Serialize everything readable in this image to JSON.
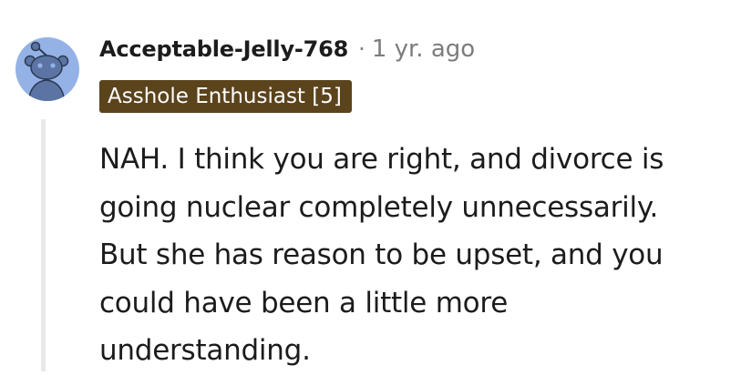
{
  "comment": {
    "author": "Acceptable-Jelly-768",
    "separator": "·",
    "age": "1 yr. ago",
    "flair": "Asshole Enthusiast [5]",
    "body_lines": [
      "NAH. I think you are right, and divorce is",
      "going nuclear completely unnecessarily.",
      "But she has reason to be upset, and you",
      "could have been a little more",
      "understanding."
    ]
  },
  "avatar_icon": "reddit-snoo-icon",
  "colors": {
    "avatar_background": "#94b2e6",
    "flair_background": "#5b431c",
    "flair_text": "#ffffff",
    "meta_text": "#7c7c7c",
    "body_text": "#1c1c1c",
    "thread_line": "#e8e8e8"
  }
}
